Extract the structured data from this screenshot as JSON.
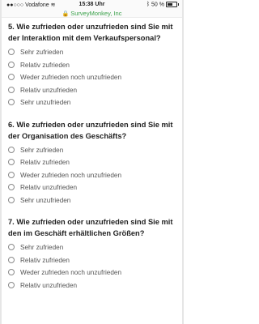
{
  "status_bar": {
    "carrier": "●●○○○ Vodafone",
    "wifi_icon": "wifi-icon",
    "time": "15:38 Uhr",
    "bluetooth_icon": "bluetooth-icon",
    "battery": "50 %",
    "battery_icon": "battery-icon"
  },
  "url_bar": {
    "lock_icon": "lock-icon",
    "site": "SurveyMonkey, Inc",
    "color": "#3aa14a"
  },
  "questions": [
    {
      "title": "5. Wie zufrieden oder unzufrieden sind Sie mit der Interaktion mit dem Verkaufspersonal?",
      "options": [
        "Sehr zufrieden",
        "Relativ zufrieden",
        "Weder zufrieden noch unzufrieden",
        "Relativ unzufrieden",
        "Sehr unzufrieden"
      ]
    },
    {
      "title": "6. Wie zufrieden oder unzufrieden sind Sie mit der Organisation des Geschäfts?",
      "options": [
        "Sehr zufrieden",
        "Relativ zufrieden",
        "Weder zufrieden noch unzufrieden",
        "Relativ unzufrieden",
        "Sehr unzufrieden"
      ]
    },
    {
      "title": "7. Wie zufrieden oder unzufrieden sind Sie mit den im Geschäft erhältlichen Größen?",
      "options": [
        "Sehr zufrieden",
        "Relativ zufrieden",
        "Weder zufrieden noch unzufrieden",
        "Relativ unzufrieden"
      ]
    }
  ]
}
